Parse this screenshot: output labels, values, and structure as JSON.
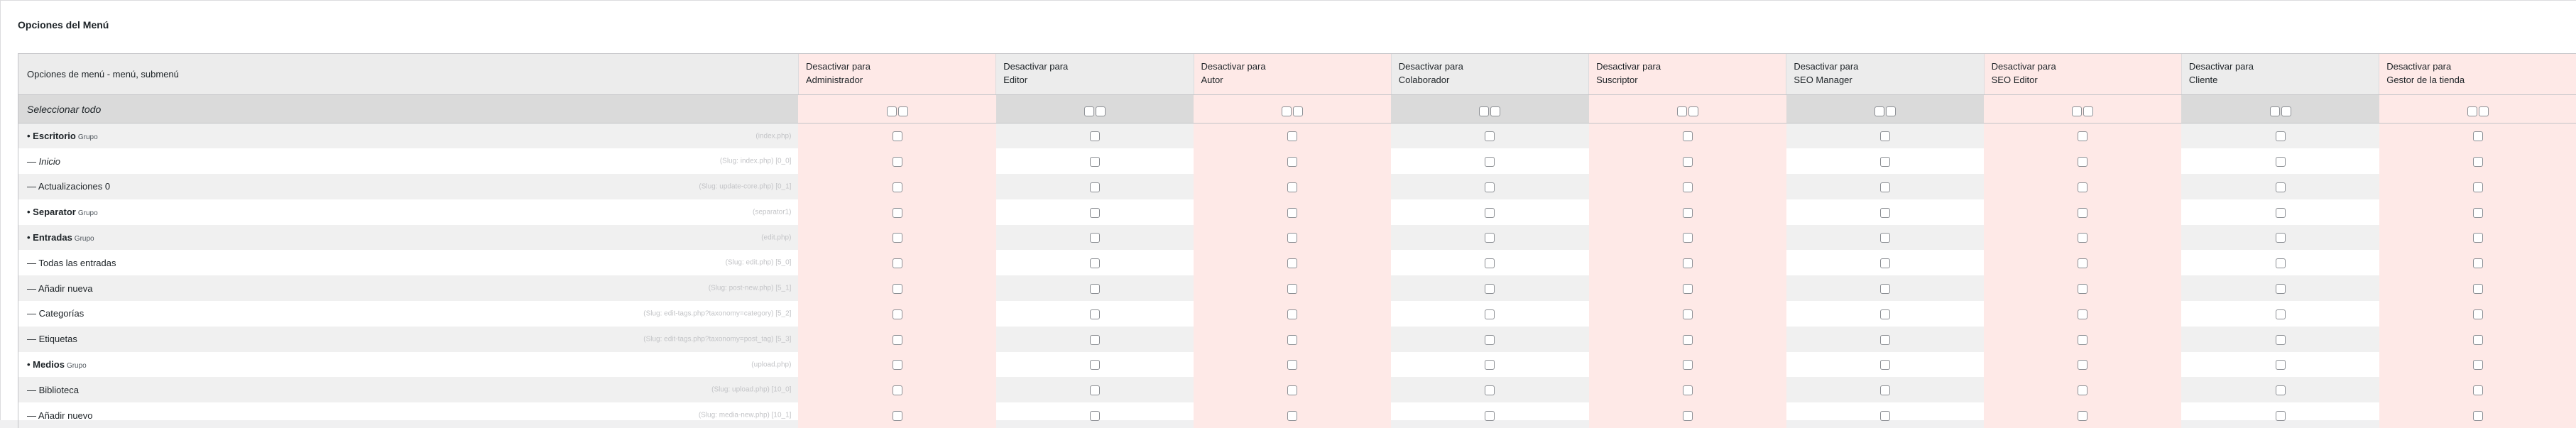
{
  "panel": {
    "title": "Opciones del Menú"
  },
  "table": {
    "first_header": "Opciones de menú - menú, submenú",
    "select_all_label": "Seleccionar todo",
    "roles": [
      {
        "line1": "Desactivar para",
        "line2": "Administrador",
        "tint": "pink"
      },
      {
        "line1": "Desactivar para",
        "line2": "Editor",
        "tint": "grey"
      },
      {
        "line1": "Desactivar para",
        "line2": "Autor",
        "tint": "pink"
      },
      {
        "line1": "Desactivar para",
        "line2": "Colaborador",
        "tint": "grey"
      },
      {
        "line1": "Desactivar para",
        "line2": "Suscriptor",
        "tint": "pink"
      },
      {
        "line1": "Desactivar para",
        "line2": "SEO Manager",
        "tint": "grey"
      },
      {
        "line1": "Desactivar para",
        "line2": "SEO Editor",
        "tint": "pink"
      },
      {
        "line1": "Desactivar para",
        "line2": "Cliente",
        "tint": "grey"
      },
      {
        "line1": "Desactivar para",
        "line2": "Gestor de la tienda",
        "tint": "pink"
      }
    ],
    "rows": [
      {
        "label": "• Escritorio",
        "group": "Grupo",
        "style": "bold",
        "slug": "(index.php)"
      },
      {
        "label": "— Inicio",
        "group": "",
        "style": "italic",
        "slug": "(Slug: index.php) [0_0]"
      },
      {
        "label": "— Actualizaciones 0",
        "group": "",
        "style": "normal",
        "slug": "(Slug: update-core.php) [0_1]"
      },
      {
        "label": "• Separator",
        "group": "Grupo",
        "style": "bold",
        "slug": "(separator1)"
      },
      {
        "label": "• Entradas",
        "group": "Grupo",
        "style": "bold",
        "slug": "(edit.php)"
      },
      {
        "label": "— Todas las entradas",
        "group": "",
        "style": "normal",
        "slug": "(Slug: edit.php) [5_0]"
      },
      {
        "label": "— Añadir nueva",
        "group": "",
        "style": "normal",
        "slug": "(Slug: post-new.php) [5_1]"
      },
      {
        "label": "— Categorías",
        "group": "",
        "style": "normal",
        "slug": "(Slug: edit-tags.php?taxonomy=category) [5_2]"
      },
      {
        "label": "— Etiquetas",
        "group": "",
        "style": "normal",
        "slug": "(Slug: edit-tags.php?taxonomy=post_tag) [5_3]"
      },
      {
        "label": "• Medios",
        "group": "Grupo",
        "style": "bold",
        "slug": "(upload.php)"
      },
      {
        "label": "— Biblioteca",
        "group": "",
        "style": "normal",
        "slug": "(Slug: upload.php) [10_0]"
      },
      {
        "label": "— Añadir nuevo",
        "group": "",
        "style": "normal",
        "slug": "(Slug: media-new.php) [10_1]"
      }
    ]
  },
  "colors": {
    "pink_column": "#fee9e7",
    "grey_column": "#ececec",
    "select_row": "#dadada",
    "alt_row": "#f0f0f0"
  }
}
